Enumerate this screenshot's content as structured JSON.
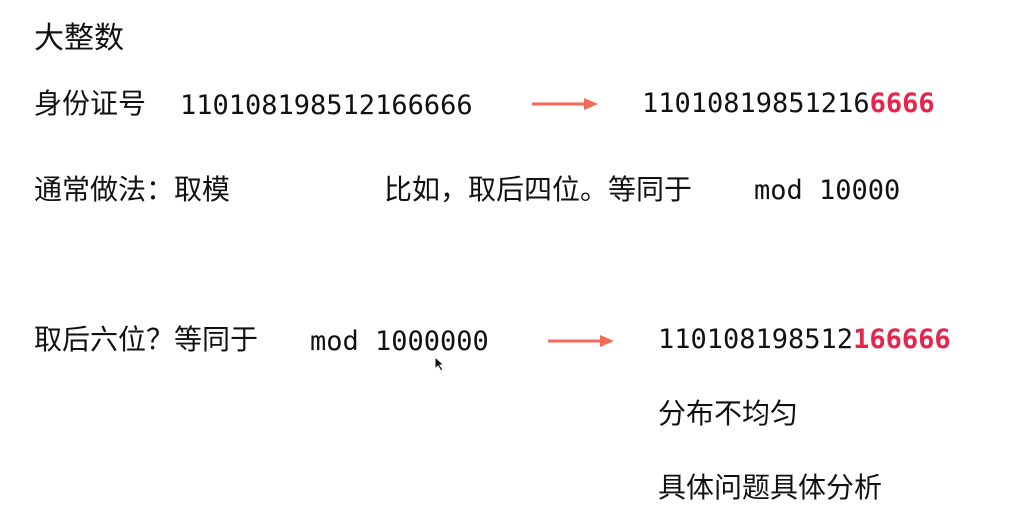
{
  "title": "大整数",
  "row1": {
    "label": "身份证号",
    "id_number": "110108198512166666",
    "result_plain": "11010819851216",
    "result_highlight": "6666"
  },
  "row2": {
    "label": "通常做法：取模",
    "example": "比如，取后四位。等同于",
    "mod": "mod 10000"
  },
  "row3": {
    "label": "取后六位？等同于",
    "mod": "mod 1000000",
    "result_plain": "110108198512",
    "result_highlight": "166666"
  },
  "note1": "分布不均匀",
  "note2": "具体问题具体分析",
  "colors": {
    "text": "#111111",
    "highlight": "#e2264d",
    "arrow": "#f26a5a"
  }
}
